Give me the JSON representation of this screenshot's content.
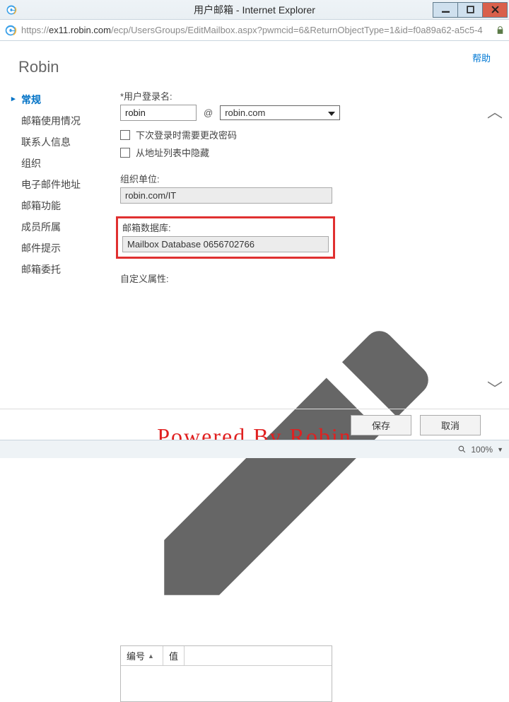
{
  "window": {
    "title": "用户邮箱 - Internet Explorer",
    "url_prefix": "https://",
    "url_host": "ex11.robin.com",
    "url_path": "/ecp/UsersGroups/EditMailbox.aspx?pwmcid=6&ReturnObjectType=1&id=f0a89a62-a5c5-4"
  },
  "help_label": "帮助",
  "page_title": "Robin",
  "sidebar": {
    "items": [
      {
        "label": "常规",
        "active": true
      },
      {
        "label": "邮箱使用情况",
        "active": false
      },
      {
        "label": "联系人信息",
        "active": false
      },
      {
        "label": "组织",
        "active": false
      },
      {
        "label": "电子邮件地址",
        "active": false
      },
      {
        "label": "邮箱功能",
        "active": false
      },
      {
        "label": "成员所属",
        "active": false
      },
      {
        "label": "邮件提示",
        "active": false
      },
      {
        "label": "邮箱委托",
        "active": false
      }
    ]
  },
  "form": {
    "login_label": "*用户登录名:",
    "login_value": "robin",
    "at": "@",
    "domain_value": "robin.com",
    "chk_change_pwd": "下次登录时需要更改密码",
    "chk_hide_gal": "从地址列表中隐藏",
    "ou_label": "组织单位:",
    "ou_value": "robin.com/IT",
    "db_label": "邮箱数据库:",
    "db_value": "Mailbox Database 0656702766",
    "custom_attr_label": "自定义属性:",
    "table_col1": "编号",
    "table_col2": "值"
  },
  "buttons": {
    "save": "保存",
    "cancel": "取消"
  },
  "status": {
    "zoom": "100%"
  },
  "watermark": "Powered By Robin"
}
